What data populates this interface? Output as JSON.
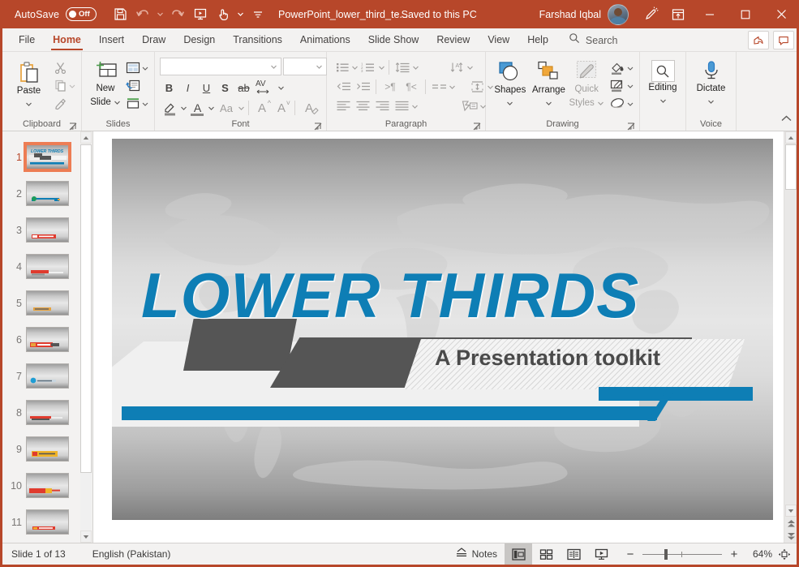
{
  "titlebar": {
    "autosave_label": "AutoSave",
    "autosave_state": "Off",
    "document_title": "PowerPoint_lower_third_te...",
    "saved_state": "- Saved to this PC",
    "user_name": "Farshad Iqbal",
    "qat_icons": [
      "save-icon",
      "undo-icon",
      "redo-icon",
      "start-from-beginning-icon",
      "touch-mode-icon",
      "customize-qat-icon"
    ],
    "window_controls": [
      "minimize",
      "maximize",
      "close"
    ],
    "ribbon_display_icon": "ribbon-display-options-icon",
    "pen_icon": "pen-icon",
    "accent_color": "#b7472a"
  },
  "tabs": [
    {
      "label": "File",
      "active": false
    },
    {
      "label": "Home",
      "active": true
    },
    {
      "label": "Insert",
      "active": false
    },
    {
      "label": "Draw",
      "active": false
    },
    {
      "label": "Design",
      "active": false
    },
    {
      "label": "Transitions",
      "active": false
    },
    {
      "label": "Animations",
      "active": false
    },
    {
      "label": "Slide Show",
      "active": false
    },
    {
      "label": "Review",
      "active": false
    },
    {
      "label": "View",
      "active": false
    },
    {
      "label": "Help",
      "active": false
    }
  ],
  "search": {
    "label": "Search",
    "icon": "search-icon"
  },
  "tabbar_buttons": [
    {
      "name": "share-button",
      "icon": "share-icon"
    },
    {
      "name": "comments-button",
      "icon": "comment-icon"
    }
  ],
  "ribbon": {
    "groups": [
      {
        "name": "Clipboard",
        "label": "Clipboard"
      },
      {
        "name": "Slides",
        "label": "Slides"
      },
      {
        "name": "Font",
        "label": "Font"
      },
      {
        "name": "Paragraph",
        "label": "Paragraph"
      },
      {
        "name": "Drawing",
        "label": "Drawing"
      },
      {
        "name": "Editing",
        "label": ""
      },
      {
        "name": "Voice",
        "label": "Voice"
      }
    ],
    "clipboard": {
      "paste_label": "Paste",
      "cut_icon": "scissors-icon",
      "copy_icon": "copy-icon",
      "format_painter_icon": "format-painter-icon"
    },
    "slides": {
      "new_slide_label": "New\nSlide",
      "new_slide_line1": "New",
      "new_slide_line2": "Slide",
      "layout_icon": "slide-layout-icon",
      "reset_icon": "reset-slide-icon",
      "section_icon": "section-icon"
    },
    "font": {
      "font_name_value": "",
      "font_size_value": "",
      "bold": "B",
      "italic": "I",
      "underline": "U",
      "shadow": "S",
      "strikethrough": "ab",
      "character_spacing": "AV",
      "text_highlight_icon": "text-highlight-icon",
      "font_color_icon": "font-color-icon",
      "change_case": "Aa",
      "increase_font": "A",
      "decrease_font": "A",
      "clear_formatting_icon": "clear-formatting-icon"
    },
    "paragraph": {
      "bullets_icon": "bullets-icon",
      "numbering_icon": "numbering-icon",
      "line_spacing_icon": "line-spacing-icon",
      "text_direction_icon": "text-direction-icon",
      "decrease_indent_icon": "decrease-indent-icon",
      "increase_indent_icon": "increase-indent-icon",
      "ltr_icon": "left-to-right-icon",
      "rtl_icon": "right-to-left-icon",
      "columns_icon": "columns-icon",
      "align_text_icon": "align-text-icon",
      "align_left_icon": "align-left-icon",
      "align_center_icon": "align-center-icon",
      "align_right_icon": "align-right-icon",
      "justify_icon": "justify-icon",
      "smartart_icon": "convert-to-smartart-icon"
    },
    "drawing": {
      "shapes_label": "Shapes",
      "arrange_label": "Arrange",
      "quick_styles_line1": "Quick",
      "quick_styles_line2": "Styles",
      "shape_fill_icon": "shape-fill-icon",
      "shape_outline_icon": "shape-outline-icon",
      "shape_effects_icon": "shape-effects-icon"
    },
    "editing": {
      "label": "Editing",
      "icon": "find-icon"
    },
    "voice": {
      "label": "Dictate",
      "group_label": "Voice",
      "icon": "microphone-icon"
    },
    "collapse_icon": "collapse-ribbon-icon"
  },
  "thumbnails": {
    "selected": 1,
    "items": [
      {
        "number": "1"
      },
      {
        "number": "2"
      },
      {
        "number": "3"
      },
      {
        "number": "4"
      },
      {
        "number": "5"
      },
      {
        "number": "6"
      },
      {
        "number": "7"
      },
      {
        "number": "8"
      },
      {
        "number": "9"
      },
      {
        "number": "10"
      },
      {
        "number": "11"
      }
    ]
  },
  "slide": {
    "title": "LOWER THIRDS",
    "subtitle": "A Presentation toolkit",
    "title_color": "#0e7eb5",
    "subtitle_color": "#4a4a4a",
    "accent_blue": "#0e7eb5",
    "dark_gray": "#555555",
    "light_panel": "#f0f0f0"
  },
  "statusbar": {
    "slide_indicator": "Slide 1 of 13",
    "language": "English (Pakistan)",
    "notes_label": "Notes",
    "views": [
      {
        "name": "normal-view",
        "icon": "normal-view-icon",
        "active": true
      },
      {
        "name": "slide-sorter-view",
        "icon": "slide-sorter-icon",
        "active": false
      },
      {
        "name": "reading-view",
        "icon": "reading-view-icon",
        "active": false
      },
      {
        "name": "slide-show-view",
        "icon": "slide-show-icon",
        "active": false
      }
    ],
    "zoom_out": "−",
    "zoom_in": "+",
    "zoom_value": "64%",
    "fit_icon": "fit-slide-to-window-icon"
  }
}
